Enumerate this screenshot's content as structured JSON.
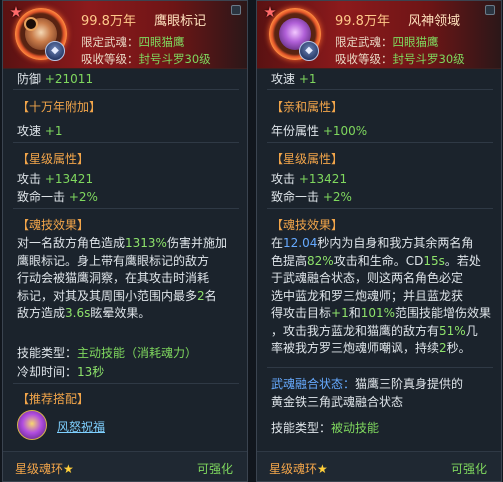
{
  "left": {
    "age": "99.8万年",
    "name": "鹰眼标记",
    "limit_label": "限定武魂：",
    "limit_value": "四眼猫鹰",
    "absorb_label": "吸收等级：",
    "absorb_value": "封号斗罗30级",
    "defense_label": "防御",
    "defense_value": "+21011",
    "sec1_title": "【十万年附加】",
    "attack_speed_label": "攻速",
    "attack_speed_value": "+1",
    "sec2_title": "【星级属性】",
    "attack_label": "攻击",
    "attack_value": "+13421",
    "crit_label": "致命一击",
    "crit_value": "+2%",
    "sec3_title": "【魂技效果】",
    "effect_lines": [
      [
        "对一名敌方角色造成",
        "1313%",
        "伤害并施加"
      ],
      [
        "鹰眼标记。身上带有鹰眼标记的敌方"
      ],
      [
        "行动会被猫鹰洞察，在其攻击时消耗"
      ],
      [
        "标记，对其及其周围小范围内最多",
        "2",
        "名"
      ],
      [
        "敌方造成",
        "3.6s",
        "眩晕效果。"
      ]
    ],
    "skill_type_label": "技能类型：",
    "skill_type_value": "主动技能（消耗魂力）",
    "cooldown_label": "冷却时间：",
    "cooldown_value": "13秒",
    "sec4_title": "【推荐搭配】",
    "support_link": "风怒祝福",
    "footer_label": "星级魂环",
    "footer_star": "★",
    "footer_action": "可强化"
  },
  "right": {
    "age": "99.8万年",
    "name": "风神领域",
    "limit_label": "限定武魂：",
    "limit_value": "四眼猫鹰",
    "absorb_label": "吸收等级：",
    "absorb_value": "封号斗罗30级",
    "speed_label": "攻速",
    "speed_value": "+1",
    "sec1_title": "【亲和属性】",
    "year_attr_label": "年份属性",
    "year_attr_value": "+100%",
    "sec2_title": "【星级属性】",
    "attack_label": "攻击",
    "attack_value": "+13421",
    "crit_label": "致命一击",
    "crit_value": "+2%",
    "sec3_title": "【魂技效果】",
    "effect_lines": [
      [
        "在",
        "12.04",
        "秒内为自身和我方其余两名角"
      ],
      [
        "色提高",
        "82%",
        "攻击和生命。CD",
        "15s",
        "。若处"
      ],
      [
        "于武魂融合状态，则这两名角色必定"
      ],
      [
        "选中蓝龙和罗三炮魂师；并且蓝龙获"
      ],
      [
        "得攻击目标",
        "+1",
        "和",
        "101%",
        "范围技能增伤效果"
      ],
      [
        "，攻击我方蓝龙和猫鹰的敌方有",
        "51%",
        "几"
      ],
      [
        "率被我方罗三炮魂师嘲讽，持续",
        "2",
        "秒。"
      ]
    ],
    "fusion_label": "武魂融合状态：",
    "fusion_text_1": "猫鹰三阶真身提供的",
    "fusion_text_2": "黄金铁三角武魂融合状态",
    "skill_type_label": "技能类型：",
    "skill_type_value": "被动技能",
    "footer_label": "星级魂环",
    "footer_star": "★",
    "footer_action": "可强化"
  }
}
